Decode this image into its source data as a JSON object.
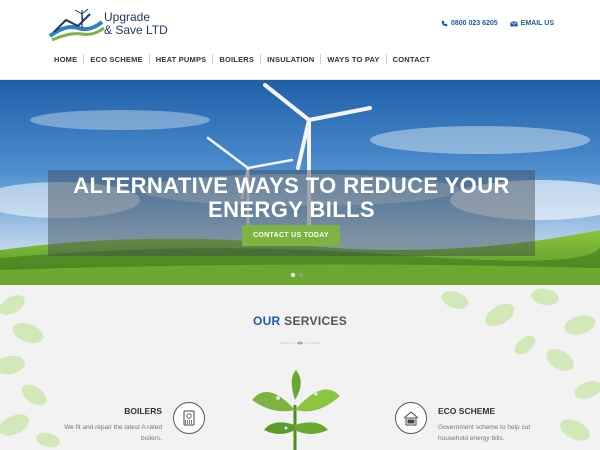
{
  "brand": {
    "line1": "Upgrade",
    "line2": "& Save LTD"
  },
  "contact": {
    "phone": "0800 023 6205",
    "email": "EMAIL US"
  },
  "nav": {
    "items": [
      "HOME",
      "ECO SCHEME",
      "HEAT PUMPS",
      "BOILERS",
      "INSULATION",
      "WAYS TO PAY",
      "CONTACT"
    ]
  },
  "hero": {
    "title_line1": "ALTERNATIVE WAYS TO REDUCE YOUR",
    "title_line2": "ENERGY BILLS",
    "button": "CONTACT US TODAY",
    "slide_count": 2,
    "active_slide": 1
  },
  "services": {
    "heading_our": "OUR",
    "heading_rest": "SERVICES",
    "items": [
      {
        "title": "BOILERS",
        "desc_line1": "We fit and repair the latest A rated",
        "desc_line2": "boilers.",
        "icon": "boiler-icon"
      },
      {
        "title": "ECO SCHEME",
        "desc_line1": "Government scheme to help cut",
        "desc_line2": "household energy bills.",
        "icon": "eco-icon"
      }
    ]
  },
  "colors": {
    "brand_blue": "#1e5aa8",
    "accent_green": "#7cb342",
    "services_bg": "#f2f2f2"
  }
}
